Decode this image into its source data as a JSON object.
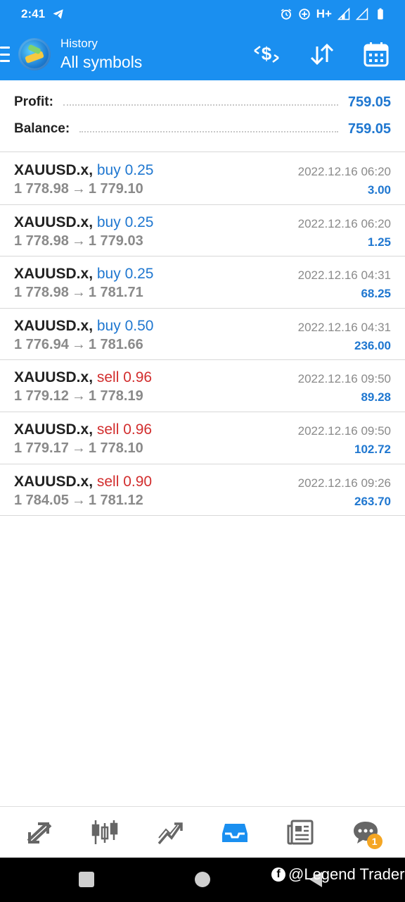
{
  "status_bar": {
    "time": "2:41",
    "network": "H+",
    "icons": [
      "telegram-icon",
      "alarm-icon",
      "data-saver-icon",
      "signal-icon",
      "signal-icon",
      "battery-icon"
    ]
  },
  "header": {
    "subtitle": "History",
    "title": "All symbols",
    "actions": [
      "currency-exchange-icon",
      "sort-icon",
      "calendar-icon"
    ]
  },
  "summary": {
    "profit_label": "Profit:",
    "profit_value": "759.05",
    "balance_label": "Balance:",
    "balance_value": "759.05"
  },
  "deals": [
    {
      "symbol": "XAUUSD.x,",
      "action": "buy 0.25",
      "side": "buy",
      "open": "1 778.98",
      "close": "1 779.10",
      "time": "2022.12.16 06:20",
      "profit": "3.00"
    },
    {
      "symbol": "XAUUSD.x,",
      "action": "buy 0.25",
      "side": "buy",
      "open": "1 778.98",
      "close": "1 779.03",
      "time": "2022.12.16 06:20",
      "profit": "1.25"
    },
    {
      "symbol": "XAUUSD.x,",
      "action": "buy 0.25",
      "side": "buy",
      "open": "1 778.98",
      "close": "1 781.71",
      "time": "2022.12.16 04:31",
      "profit": "68.25"
    },
    {
      "symbol": "XAUUSD.x,",
      "action": "buy 0.50",
      "side": "buy",
      "open": "1 776.94",
      "close": "1 781.66",
      "time": "2022.12.16 04:31",
      "profit": "236.00"
    },
    {
      "symbol": "XAUUSD.x,",
      "action": "sell 0.96",
      "side": "sell",
      "open": "1 779.12",
      "close": "1 778.19",
      "time": "2022.12.16 09:50",
      "profit": "89.28"
    },
    {
      "symbol": "XAUUSD.x,",
      "action": "sell 0.96",
      "side": "sell",
      "open": "1 779.17",
      "close": "1 778.10",
      "time": "2022.12.16 09:50",
      "profit": "102.72"
    },
    {
      "symbol": "XAUUSD.x,",
      "action": "sell 0.90",
      "side": "sell",
      "open": "1 784.05",
      "close": "1 781.12",
      "time": "2022.12.16 09:26",
      "profit": "263.70"
    }
  ],
  "arrow": "→",
  "bottom_nav": {
    "items": [
      "quotes-icon",
      "chart-icon",
      "trade-icon",
      "history-icon",
      "news-icon",
      "chat-icon"
    ],
    "active": "history-icon",
    "chat_badge": "1"
  },
  "watermark": {
    "logo": "f",
    "text": "@Legend Trader"
  },
  "colors": {
    "brand": "#1a8ff0",
    "profit": "#1f77d0",
    "buy": "#1f77d0",
    "sell": "#d22e2e"
  }
}
